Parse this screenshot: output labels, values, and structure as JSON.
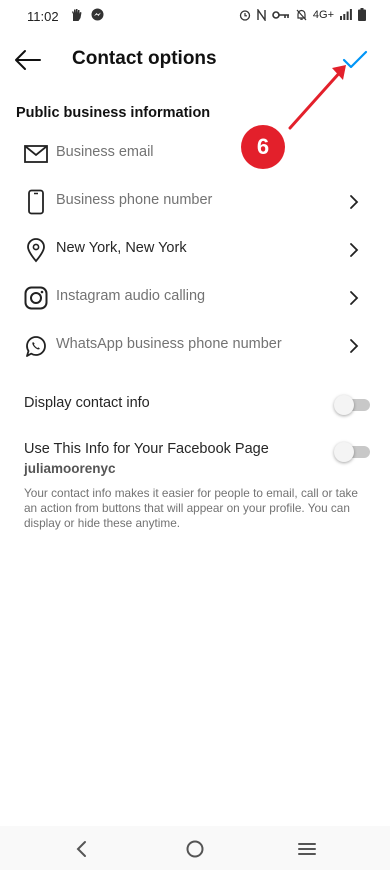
{
  "status_bar": {
    "time": "11:02",
    "network": "4G+"
  },
  "header": {
    "title": "Contact options"
  },
  "section": {
    "label": "Public business information"
  },
  "options": [
    {
      "label": "Business email",
      "icon": "mail-icon",
      "has_value": false,
      "chevron": false
    },
    {
      "label": "Business phone number",
      "icon": "phone-icon",
      "has_value": false,
      "chevron": true
    },
    {
      "label": "New York, New York",
      "icon": "location-pin-icon",
      "has_value": true,
      "chevron": true
    },
    {
      "label": "Instagram audio calling",
      "icon": "instagram-icon",
      "has_value": false,
      "chevron": true
    },
    {
      "label": "WhatsApp business phone number",
      "icon": "whatsapp-icon",
      "has_value": false,
      "chevron": true
    }
  ],
  "toggles": {
    "display_contact_info": {
      "label": "Display contact info",
      "on": false
    },
    "facebook_page": {
      "label": "Use This Info for Your Facebook Page",
      "account": "juliamoorenyc",
      "on": false
    }
  },
  "info_text": "Your contact info makes it easier for people to email, call or take an action from buttons that will appear on your profile. You can display or hide these anytime.",
  "annotation": {
    "step": "6"
  },
  "colors": {
    "accent": "#0095f6",
    "annotation": "#e3202b",
    "muted_text": "#737373"
  }
}
